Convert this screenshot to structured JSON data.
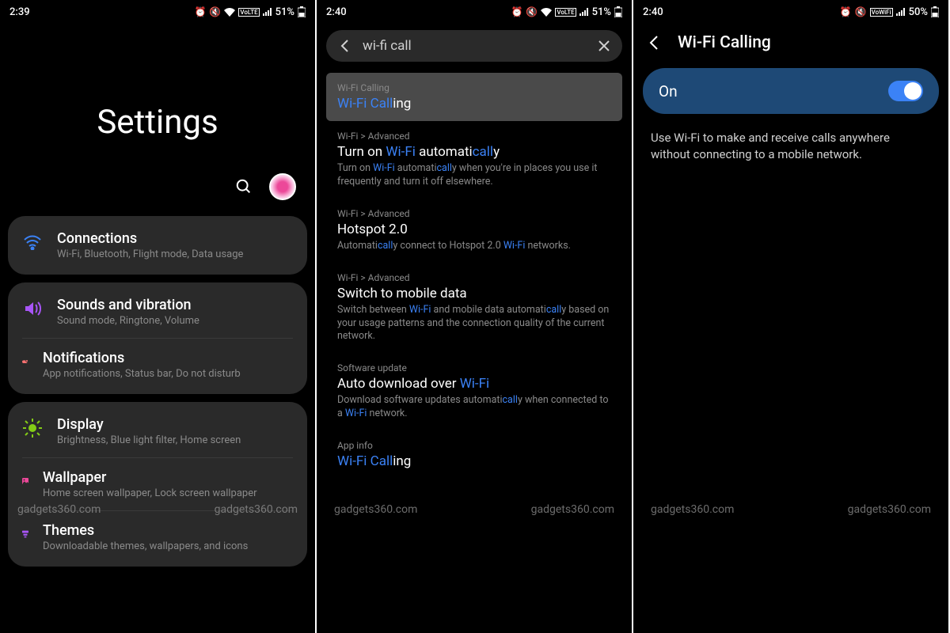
{
  "watermark": "gadgets360.com",
  "panel1": {
    "status": {
      "time": "2:39",
      "battery": "51%"
    },
    "title": "Settings",
    "items": [
      {
        "icon": "wifi",
        "color": "#3b82f6",
        "title": "Connections",
        "sub": "Wi-Fi, Bluetooth, Flight mode, Data usage"
      },
      {
        "icon": "sound",
        "color": "#a855f7",
        "title": "Sounds and vibration",
        "sub": "Sound mode, Ringtone, Volume"
      },
      {
        "icon": "notif",
        "color": "#f87171",
        "title": "Notifications",
        "sub": "App notifications, Status bar, Do not disturb"
      },
      {
        "icon": "display",
        "color": "#84cc16",
        "title": "Display",
        "sub": "Brightness, Blue light filter, Home screen"
      },
      {
        "icon": "wallpaper",
        "color": "#ec4899",
        "title": "Wallpaper",
        "sub": "Home screen wallpaper, Lock screen wallpaper"
      },
      {
        "icon": "themes",
        "color": "#a855f7",
        "title": "Themes",
        "sub": "Downloadable themes, wallpapers, and icons"
      }
    ]
  },
  "panel2": {
    "status": {
      "time": "2:40",
      "battery": "51%"
    },
    "search": "wi-fi call",
    "results": [
      {
        "path": "Wi-Fi Calling",
        "title_hl": "Wi-Fi Call",
        "title_rest": "ing",
        "desc": "",
        "active": true
      },
      {
        "path": "Wi-Fi > Advanced",
        "title_pre": "Turn on ",
        "title_hl": "Wi-Fi",
        "title_post": " automatically",
        "desc_parts": [
          "Turn on ",
          "Wi-Fi",
          " automati",
          "call",
          "y when you're in places you use it frequently and turn it off elsewhere."
        ]
      },
      {
        "path": "Wi-Fi > Advanced",
        "title": "Hotspot 2.0",
        "desc_parts": [
          "Automati",
          "call",
          "y connect to Hotspot 2.0 ",
          "Wi-Fi",
          " networks."
        ]
      },
      {
        "path": "Wi-Fi > Advanced",
        "title": "Switch to mobile data",
        "desc_parts": [
          "Switch between ",
          "Wi-Fi",
          " and mobile data automati",
          "call",
          "y based on your usage patterns and the connection quality of the current network."
        ]
      },
      {
        "path": "Software update",
        "title_pre": "Auto download over ",
        "title_hl": "Wi-Fi",
        "desc_parts": [
          "Download software updates automati",
          "call",
          "y when connected to a ",
          "Wi-Fi",
          " network."
        ]
      },
      {
        "path": "App info",
        "title_hl": "Wi-Fi Call",
        "title_rest": "ing"
      }
    ]
  },
  "panel3": {
    "status": {
      "time": "2:40",
      "battery": "50%"
    },
    "title": "Wi-Fi Calling",
    "toggle_label": "On",
    "description": "Use Wi-Fi to make and receive calls anywhere without connecting to a mobile network."
  }
}
